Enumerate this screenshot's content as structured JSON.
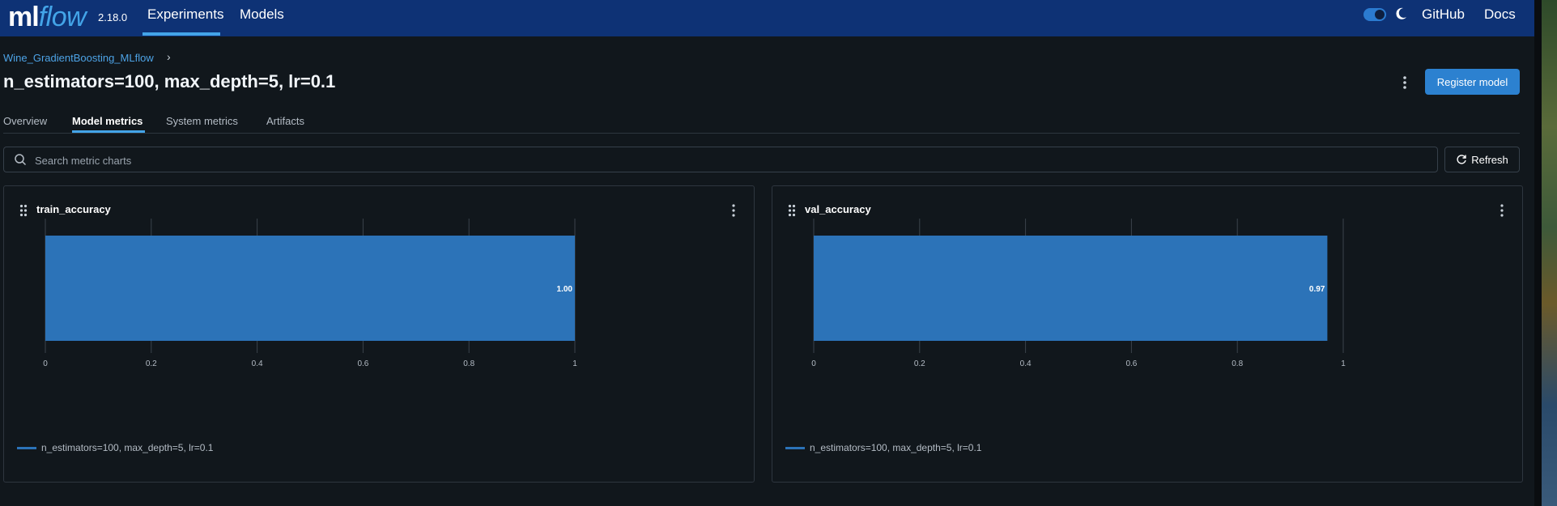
{
  "app": {
    "logo_ml": "ml",
    "logo_flow": "flow",
    "version": "2.18.0",
    "nav": [
      {
        "label": "Experiments",
        "active": true
      },
      {
        "label": "Models",
        "active": false
      }
    ],
    "github_label": "GitHub",
    "docs_label": "Docs",
    "dark_mode_on": true
  },
  "breadcrumb": {
    "experiment": "Wine_GradientBoosting_MLflow",
    "chevron": "›"
  },
  "run": {
    "title": "n_estimators=100, max_depth=5, lr=0.1"
  },
  "actions": {
    "register_label": "Register model",
    "more_icon": "kebab-icon"
  },
  "tabs": [
    {
      "label": "Overview",
      "active": false
    },
    {
      "label": "Model metrics",
      "active": true
    },
    {
      "label": "System metrics",
      "active": false
    },
    {
      "label": "Artifacts",
      "active": false
    }
  ],
  "search": {
    "placeholder": "Search metric charts",
    "value": ""
  },
  "refresh_label": "Refresh",
  "colors": {
    "accent": "#43a4e8",
    "bar": "#2c73b8",
    "nav_bg": "#0e3275",
    "page_bg": "#11171c"
  },
  "chart_data": [
    {
      "type": "bar",
      "orientation": "horizontal",
      "title": "train_accuracy",
      "categories": [
        "n_estimators=100, max_depth=5, lr=0.1"
      ],
      "values": [
        1.0
      ],
      "data_labels": [
        "1.00"
      ],
      "xlim": [
        0,
        1
      ],
      "xticks": [
        "0",
        "0.2",
        "0.4",
        "0.6",
        "0.8",
        "1"
      ],
      "grid": true,
      "legend": {
        "position": "bottom-left",
        "entries": [
          "n_estimators=100, max_depth=5, lr=0.1"
        ]
      }
    },
    {
      "type": "bar",
      "orientation": "horizontal",
      "title": "val_accuracy",
      "categories": [
        "n_estimators=100, max_depth=5, lr=0.1"
      ],
      "values": [
        0.97
      ],
      "data_labels": [
        "0.97"
      ],
      "xlim": [
        0,
        1
      ],
      "xticks": [
        "0",
        "0.2",
        "0.4",
        "0.6",
        "0.8",
        "1"
      ],
      "grid": true,
      "legend": {
        "position": "bottom-left",
        "entries": [
          "n_estimators=100, max_depth=5, lr=0.1"
        ]
      }
    }
  ]
}
